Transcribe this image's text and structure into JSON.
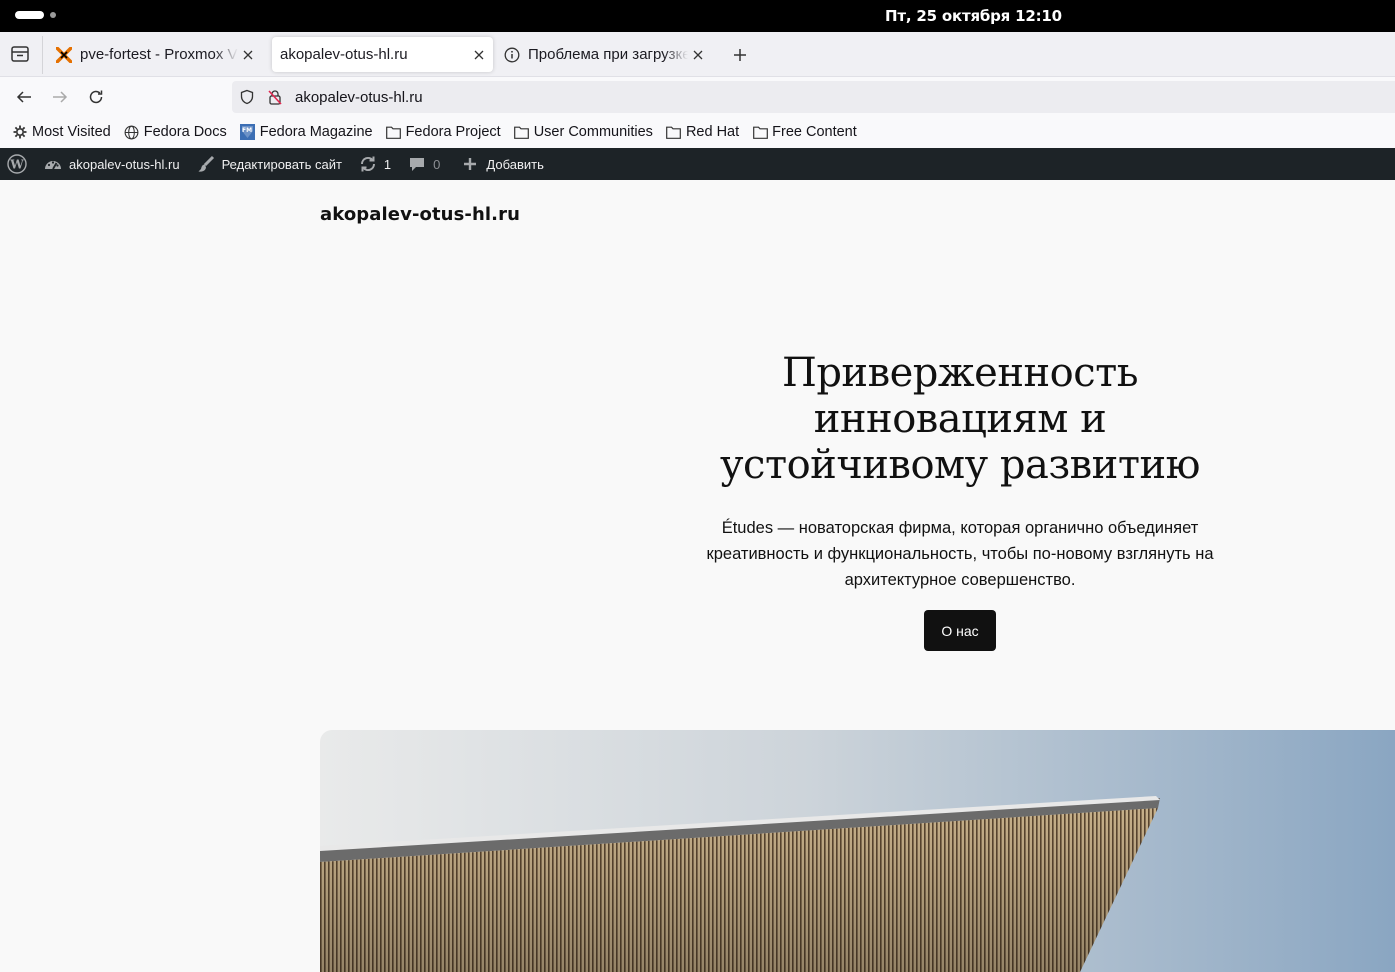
{
  "system": {
    "datetime": "Пт, 25 октября  12:10"
  },
  "tabs": [
    {
      "title": "pve-fortest - Proxmox Virtual Environment"
    },
    {
      "title": "akopalev-otus-hl.ru"
    },
    {
      "title": "Проблема при загрузке страницы"
    }
  ],
  "address_bar": {
    "url": "akopalev-otus-hl.ru"
  },
  "bookmarks": [
    {
      "label": "Most Visited",
      "icon": "gear-icon"
    },
    {
      "label": "Fedora Docs",
      "icon": "globe-icon"
    },
    {
      "label": "Fedora Magazine",
      "icon": "fedora-magazine-icon"
    },
    {
      "label": "Fedora Project",
      "icon": "folder-icon"
    },
    {
      "label": "User Communities",
      "icon": "folder-icon"
    },
    {
      "label": "Red Hat",
      "icon": "folder-icon"
    },
    {
      "label": "Free Content",
      "icon": "folder-icon"
    }
  ],
  "admin_bar": {
    "site_name": "akopalev-otus-hl.ru",
    "edit_site": "Редактировать сайт",
    "updates_count": "1",
    "comments_count": "0",
    "add_new": "Добавить"
  },
  "page": {
    "site_title": "akopalev-otus-hl.ru",
    "hero_heading": "Приверженность инновациям и устойчивому развитию",
    "hero_text": "Études — новаторская фирма, которая органично объединяет креативность и функциональность, чтобы по-новому взглянуть на архитектурное совершенство.",
    "cta_label": "О нас"
  },
  "colors": {
    "admin_bar_bg": "#1d2327",
    "page_bg": "#f9f9f9",
    "button_bg": "#111111"
  }
}
